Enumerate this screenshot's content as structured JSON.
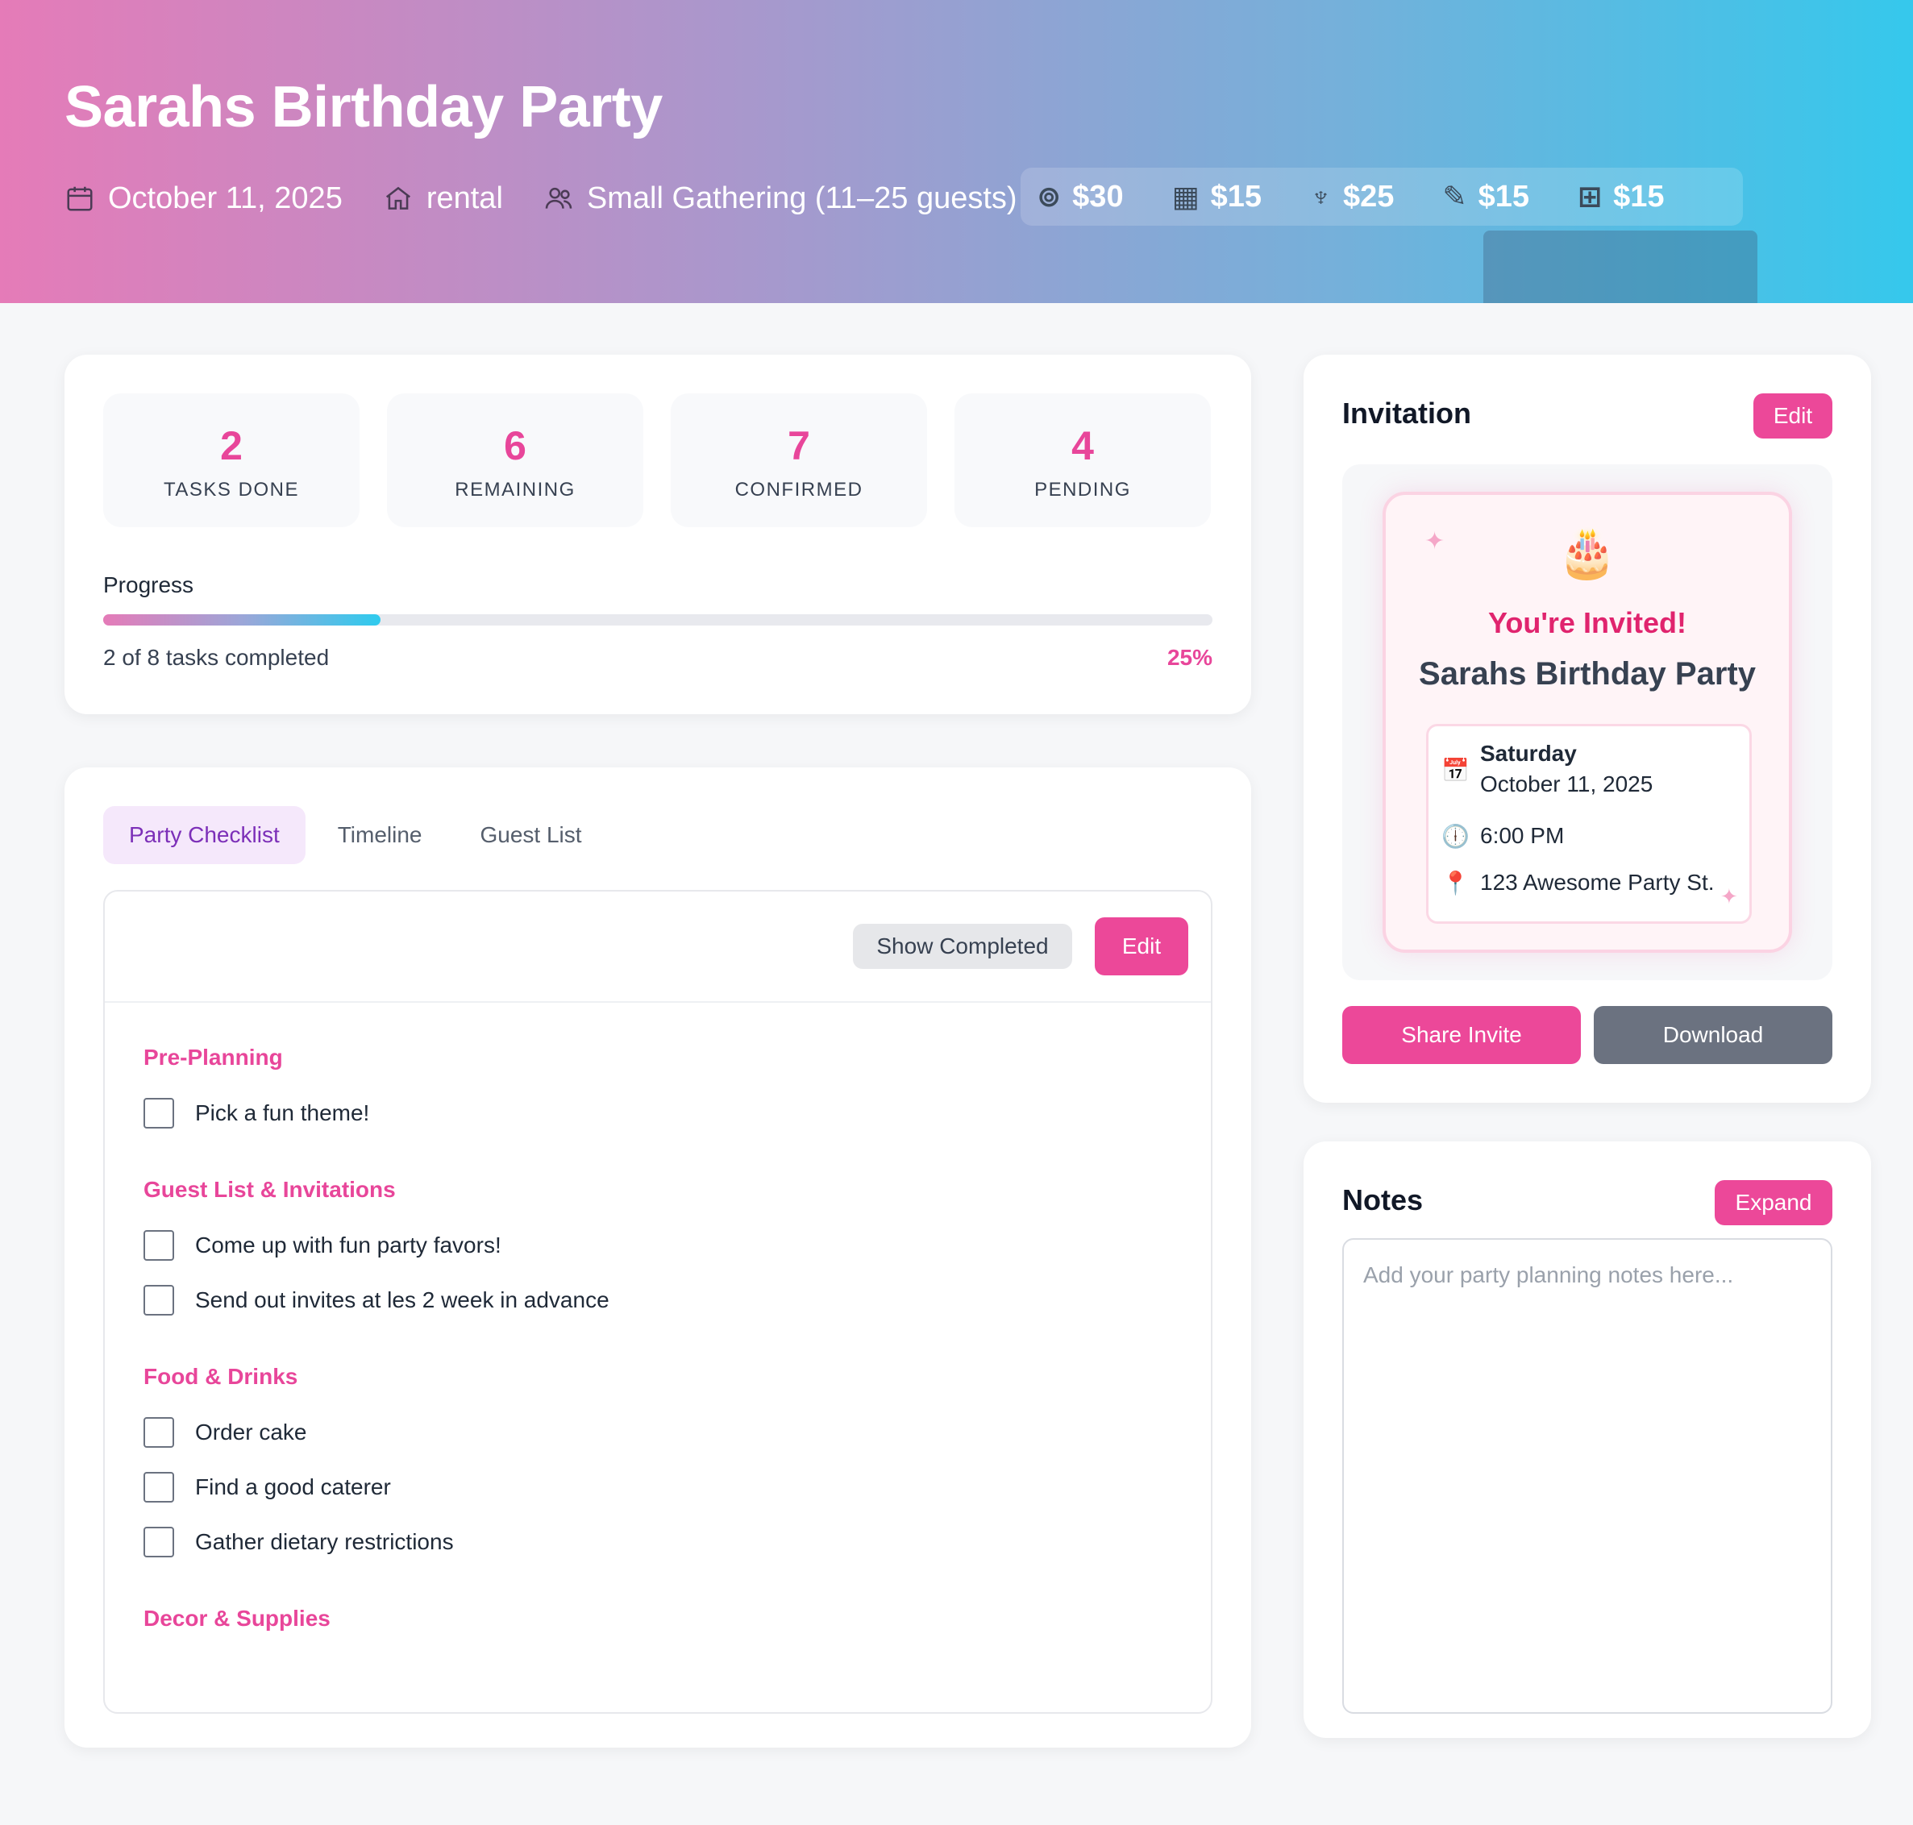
{
  "header": {
    "title": "Sarahs Birthday Party",
    "date": "October 11, 2025",
    "venue": "rental",
    "size": "Small Gathering (11–25 guests)",
    "budget": [
      {
        "icon": "utensils-icon",
        "amount": "$30"
      },
      {
        "icon": "building-icon",
        "amount": "$15"
      },
      {
        "icon": "palm-tree-icon",
        "amount": "$25"
      },
      {
        "icon": "pen-icon",
        "amount": "$15"
      },
      {
        "icon": "gift-icon",
        "amount": "$15"
      }
    ]
  },
  "stats": [
    {
      "value": "2",
      "label": "TASKS DONE"
    },
    {
      "value": "6",
      "label": "REMAINING"
    },
    {
      "value": "7",
      "label": "CONFIRMED"
    },
    {
      "value": "4",
      "label": "PENDING"
    }
  ],
  "progress": {
    "label": "Progress",
    "text": "2 of 8 tasks completed",
    "percent_label": "25%",
    "fraction": 0.25
  },
  "tabs": [
    {
      "label": "Party Checklist",
      "active": true
    },
    {
      "label": "Timeline",
      "active": false
    },
    {
      "label": "Guest List",
      "active": false
    }
  ],
  "checklist": {
    "show_completed_label": "Show Completed",
    "edit_label": "Edit",
    "sections": [
      {
        "title": "Pre-Planning",
        "tasks": [
          "Pick a fun theme!"
        ]
      },
      {
        "title": "Guest List & Invitations",
        "tasks": [
          "Come up with fun party favors!",
          "Send out invites at les 2 week in advance"
        ]
      },
      {
        "title": "Food & Drinks",
        "tasks": [
          "Order cake",
          "Find a good caterer",
          "Gather dietary restrictions"
        ]
      },
      {
        "title": "Decor & Supplies",
        "tasks": []
      }
    ]
  },
  "invitation": {
    "heading": "Invitation",
    "edit_label": "Edit",
    "headline": "You're Invited!",
    "event_name": "Sarahs Birthday Party",
    "day": "Saturday",
    "date": "October 11, 2025",
    "time": "6:00 PM",
    "address": "123 Awesome Party St.",
    "share_label": "Share Invite",
    "download_label": "Download"
  },
  "notes": {
    "heading": "Notes",
    "expand_label": "Expand",
    "placeholder": "Add your party planning notes here..."
  },
  "colors": {
    "accent": "#ec4899",
    "accent_text": "#e8469a",
    "tab_active_bg": "#f5e8fb",
    "tab_active_text": "#7c2fb8"
  }
}
